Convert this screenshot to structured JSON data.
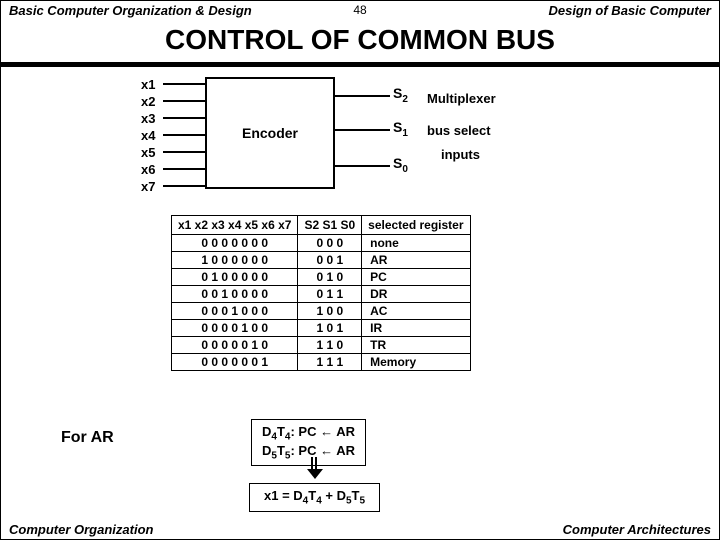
{
  "header": {
    "left": "Basic Computer Organization & Design",
    "page": "48",
    "right": "Design of Basic Computer"
  },
  "title": "CONTROL  OF  COMMON  BUS",
  "inputs": [
    "x1",
    "x2",
    "x3",
    "x4",
    "x5",
    "x6",
    "x7"
  ],
  "encoder_label": "Encoder",
  "outputs": {
    "s2": "S",
    "s2sub": "2",
    "s1": "S",
    "s1sub": "1",
    "s0": "S",
    "s0sub": "0"
  },
  "side_text": {
    "mux": "Multiplexer",
    "bus": "bus select",
    "inp": "inputs"
  },
  "table": {
    "hx": "x1 x2 x3 x4 x5 x6 x7",
    "hs": "S2 S1 S0",
    "hreg": "selected register",
    "rows": [
      {
        "x": "0 0 0 0 0 0 0",
        "s": "0  0  0",
        "r": "none"
      },
      {
        "x": "1 0 0 0 0 0 0",
        "s": "0  0  1",
        "r": "AR"
      },
      {
        "x": "0 1 0 0 0 0 0",
        "s": "0  1  0",
        "r": "PC"
      },
      {
        "x": "0 0 1 0 0 0 0",
        "s": "0  1  1",
        "r": "DR"
      },
      {
        "x": "0 0 0 1 0 0 0",
        "s": "1  0  0",
        "r": "AC"
      },
      {
        "x": "0 0 0 0 1 0 0",
        "s": "1  0  1",
        "r": "IR"
      },
      {
        "x": "0 0 0 0 0 1 0",
        "s": "1  1  0",
        "r": "TR"
      },
      {
        "x": "0 0 0 0 0 0 1",
        "s": "1  1  1",
        "r": "Memory"
      }
    ]
  },
  "for_ar": "For AR",
  "transfers": {
    "l1a": "D",
    "l1asub": "4",
    "l1b": "T",
    "l1bsub": "4",
    "l1c": ":  PC ",
    "l1d": " AR",
    "l2a": "D",
    "l2asub": "5",
    "l2b": "T",
    "l2bsub": "5",
    "l2c": ":  PC ",
    "l2d": " AR"
  },
  "equation": {
    "p1": "x1 = D",
    "s1": "4",
    "p2": "T",
    "s2": "4",
    "p3": " + D",
    "s3": "5",
    "p4": "T",
    "s4": "5"
  },
  "footer": {
    "left": "Computer Organization",
    "right": "Computer Architectures"
  },
  "chart_data": {
    "type": "table",
    "title": "Bus select encoder truth table",
    "columns": [
      "x1",
      "x2",
      "x3",
      "x4",
      "x5",
      "x6",
      "x7",
      "S2",
      "S1",
      "S0",
      "selected register"
    ],
    "rows": [
      [
        0,
        0,
        0,
        0,
        0,
        0,
        0,
        0,
        0,
        0,
        "none"
      ],
      [
        1,
        0,
        0,
        0,
        0,
        0,
        0,
        0,
        0,
        1,
        "AR"
      ],
      [
        0,
        1,
        0,
        0,
        0,
        0,
        0,
        0,
        1,
        0,
        "PC"
      ],
      [
        0,
        0,
        1,
        0,
        0,
        0,
        0,
        0,
        1,
        1,
        "DR"
      ],
      [
        0,
        0,
        0,
        1,
        0,
        0,
        0,
        1,
        0,
        0,
        "AC"
      ],
      [
        0,
        0,
        0,
        0,
        1,
        0,
        0,
        1,
        0,
        1,
        "IR"
      ],
      [
        0,
        0,
        0,
        0,
        0,
        1,
        0,
        1,
        1,
        0,
        "TR"
      ],
      [
        0,
        0,
        0,
        0,
        0,
        0,
        1,
        1,
        1,
        1,
        "Memory"
      ]
    ]
  }
}
